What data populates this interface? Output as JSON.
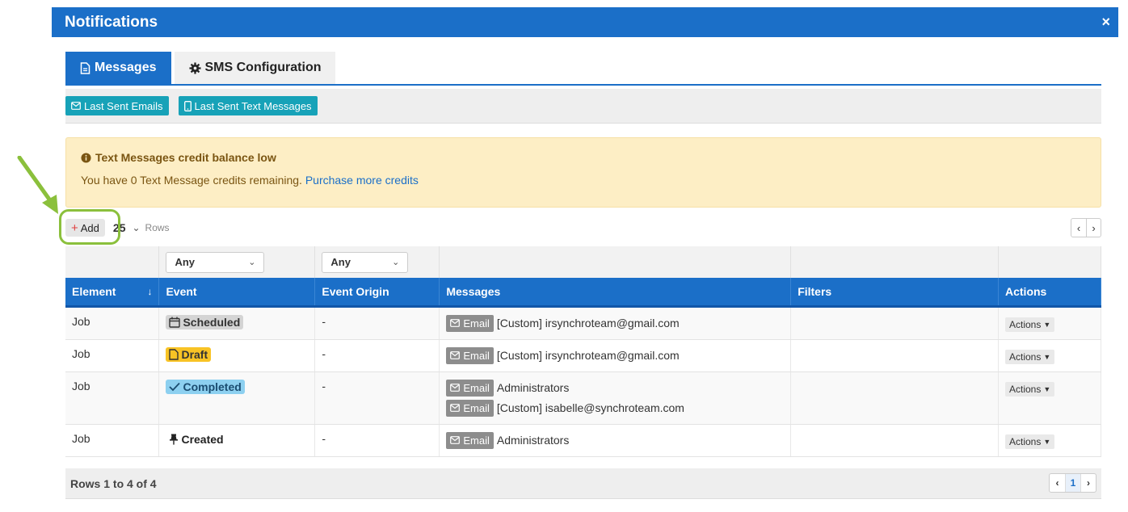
{
  "modal": {
    "title": "Notifications",
    "close_glyph": "×"
  },
  "tabs": [
    {
      "label": "Messages",
      "icon": "file-icon",
      "active": true
    },
    {
      "label": "SMS Configuration",
      "icon": "gear-icon",
      "active": false
    }
  ],
  "toolbar": {
    "emails_label": "Last Sent Emails",
    "texts_label": "Last Sent Text Messages"
  },
  "alert": {
    "title": "Text Messages credit balance low",
    "message": "You have 0 Text Message credits remaining.",
    "link": "Purchase more credits"
  },
  "controls": {
    "add_label": "Add",
    "rows_value": "25",
    "rows_label": "Rows",
    "prev": "‹",
    "next": "›"
  },
  "filters": {
    "event": "Any",
    "origin": "Any"
  },
  "table": {
    "columns": [
      "Element",
      "Event",
      "Event Origin",
      "Messages",
      "Filters",
      "Actions"
    ],
    "rows": [
      {
        "element": "Job",
        "event": "Scheduled",
        "origin": "-",
        "messages": [
          {
            "tag": "Email",
            "text": "[Custom] irsynchroteam@gmail.com"
          }
        ],
        "filters": "",
        "actions": "Actions"
      },
      {
        "element": "Job",
        "event": "Draft",
        "origin": "-",
        "messages": [
          {
            "tag": "Email",
            "text": "[Custom] irsynchroteam@gmail.com"
          }
        ],
        "filters": "",
        "actions": "Actions"
      },
      {
        "element": "Job",
        "event": "Completed",
        "origin": "-",
        "messages": [
          {
            "tag": "Email",
            "text": "Administrators"
          },
          {
            "tag": "Email",
            "text": "[Custom] isabelle@synchroteam.com"
          }
        ],
        "filters": "",
        "actions": "Actions"
      },
      {
        "element": "Job",
        "event": "Created",
        "origin": "-",
        "messages": [
          {
            "tag": "Email",
            "text": "Administrators"
          }
        ],
        "filters": "",
        "actions": "Actions"
      }
    ]
  },
  "footer": {
    "summary": "Rows 1 to 4 of 4",
    "page": "1"
  },
  "colors": {
    "primary": "#1b6fc8",
    "info": "#17a2b8",
    "warning_bg": "#fdeec5",
    "highlight": "#8bc03c"
  }
}
